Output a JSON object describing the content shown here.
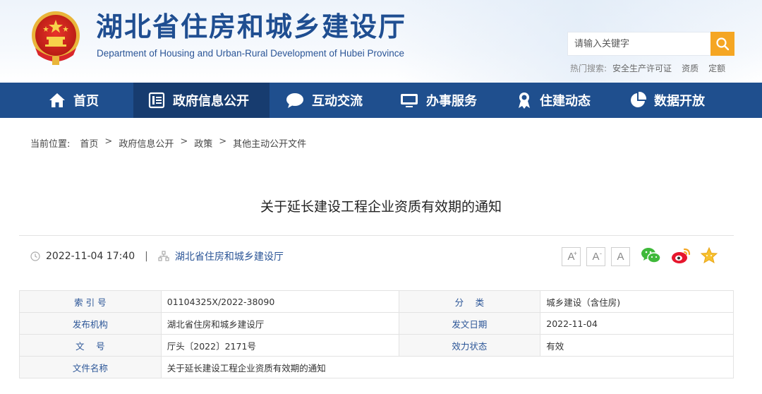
{
  "header": {
    "title": "湖北省住房和城乡建设厅",
    "subtitle": "Department of Housing and Urban-Rural Development of Hubei Province",
    "emblem_icon": "national-emblem-icon"
  },
  "search": {
    "placeholder": "请输入关键字",
    "hot_label": "热门搜索:",
    "hot_terms": [
      "安全生产许可证",
      "资质",
      "定额"
    ]
  },
  "nav": {
    "items": [
      {
        "label": "首页",
        "icon": "home-icon"
      },
      {
        "label": "政府信息公开",
        "icon": "document-list-icon"
      },
      {
        "label": "互动交流",
        "icon": "chat-bubble-icon"
      },
      {
        "label": "办事服务",
        "icon": "monitor-icon"
      },
      {
        "label": "住建动态",
        "icon": "award-badge-icon"
      },
      {
        "label": "数据开放",
        "icon": "pie-chart-icon"
      }
    ],
    "active_index": 1
  },
  "breadcrumb": {
    "label": "当前位置:",
    "items": [
      "首页",
      "政府信息公开",
      "政策",
      "其他主动公开文件"
    ],
    "separator": ">"
  },
  "article": {
    "title": "关于延长建设工程企业资质有效期的通知",
    "datetime": "2022-11-04 17:40",
    "separator": "|",
    "publisher": "湖北省住房和城乡建设厅"
  },
  "font_controls": [
    "A",
    "A",
    "A"
  ],
  "share_icons": [
    "wechat-icon",
    "weibo-icon",
    "favorite-star-icon"
  ],
  "info_table": {
    "rows": [
      [
        {
          "k": "索 引 号",
          "v": "01104325X/2022-38090"
        },
        {
          "k": "分　 类",
          "v": "城乡建设（含住房)"
        }
      ],
      [
        {
          "k": "发布机构",
          "v": "湖北省住房和城乡建设厅"
        },
        {
          "k": "发文日期",
          "v": "2022-11-04"
        }
      ],
      [
        {
          "k": "文　 号",
          "v": "厅头〔2022〕2171号"
        },
        {
          "k": "效力状态",
          "v": "有效"
        }
      ],
      [
        {
          "k": "文件名称",
          "v": "关于延长建设工程企业资质有效期的通知"
        }
      ]
    ]
  },
  "colors": {
    "nav_bg": "#1f4f8e",
    "nav_active": "#173c6f",
    "accent": "#f5a623",
    "title_blue": "#1f4e91"
  }
}
